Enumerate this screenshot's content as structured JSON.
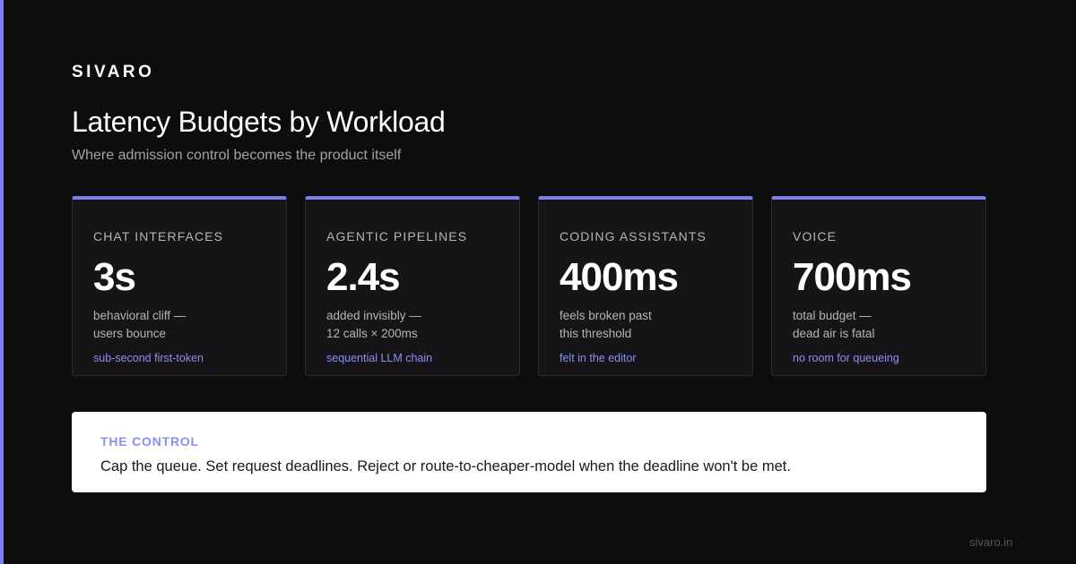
{
  "brand": "SIVARO",
  "title": "Latency Budgets by Workload",
  "subtitle": "Where admission control becomes the product itself",
  "cards": [
    {
      "label": "CHAT INTERFACES",
      "value": "3s",
      "desc_line1": "behavioral cliff —",
      "desc_line2": "users bounce",
      "note": "sub-second first-token"
    },
    {
      "label": "AGENTIC PIPELINES",
      "value": "2.4s",
      "desc_line1": "added invisibly —",
      "desc_line2": "12 calls × 200ms",
      "note": "sequential LLM chain"
    },
    {
      "label": "CODING ASSISTANTS",
      "value": "400ms",
      "desc_line1": "feels broken past",
      "desc_line2": "this threshold",
      "note": "felt in the editor"
    },
    {
      "label": "VOICE",
      "value": "700ms",
      "desc_line1": "total budget —",
      "desc_line2": "dead air is fatal",
      "note": "no room for queueing"
    }
  ],
  "control": {
    "label": "THE CONTROL",
    "text": "Cap the queue. Set request deadlines. Reject or route-to-cheaper-model when the deadline won't be met."
  },
  "footer_url": "sivaro.in",
  "colors": {
    "accent": "#7b7ff0",
    "background": "#0d0d0d",
    "card_background": "#151517",
    "note_text": "#8a8ff5"
  }
}
